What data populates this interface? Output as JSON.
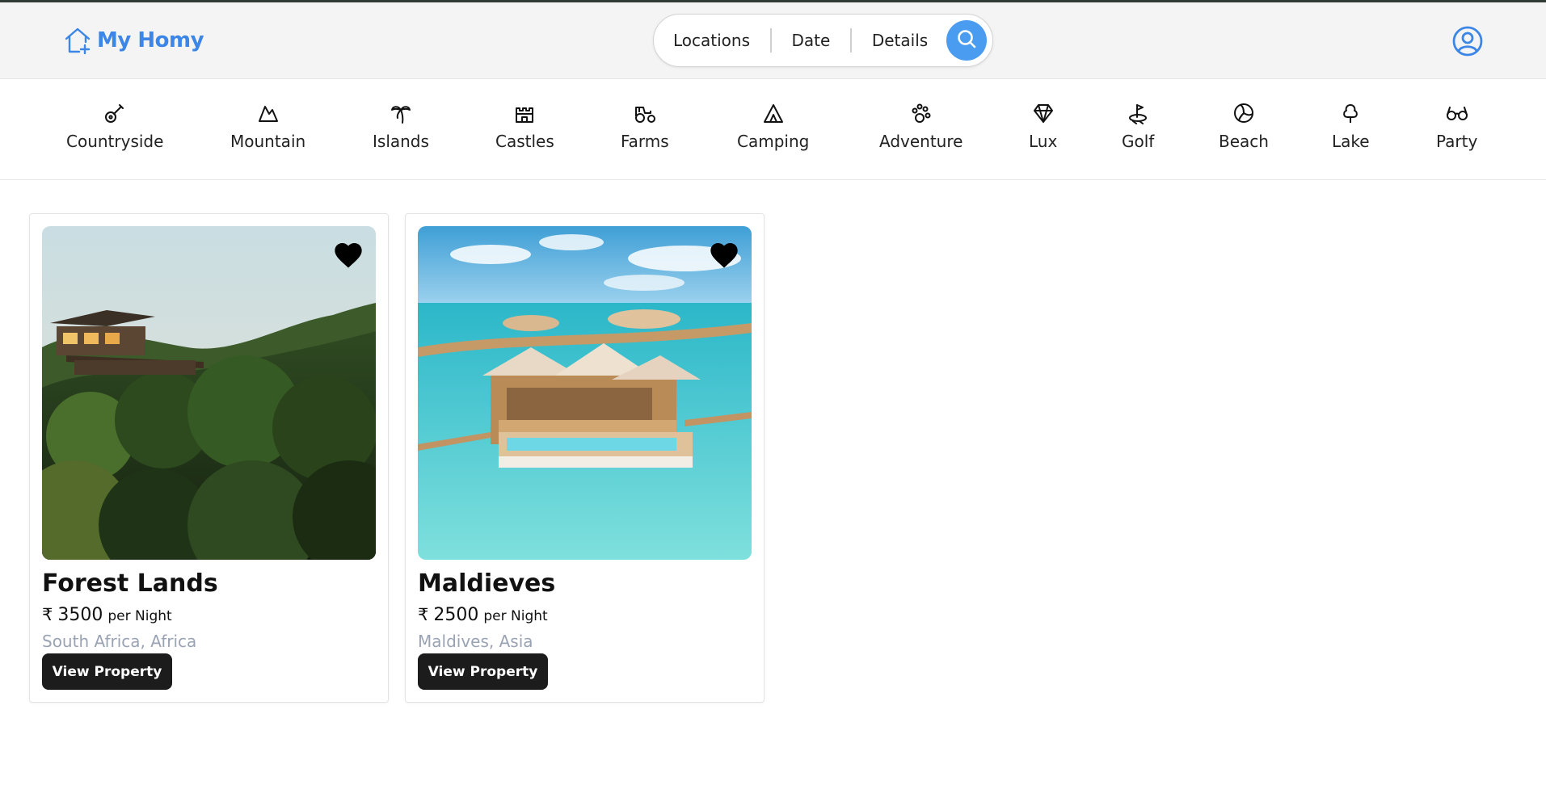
{
  "app": {
    "name": "My Homy",
    "brand_color": "#3b86e6"
  },
  "search": {
    "segments": [
      "Locations",
      "Date",
      "Details"
    ],
    "button_icon": "search-icon",
    "button_color": "#4a9cf0"
  },
  "header": {
    "profile_icon": "user-circle-icon"
  },
  "categories": [
    {
      "label": "Countryside",
      "icon": "guitar-icon"
    },
    {
      "label": "Mountain",
      "icon": "mountain-icon"
    },
    {
      "label": "Islands",
      "icon": "palm-tree-icon"
    },
    {
      "label": "Castles",
      "icon": "castle-icon"
    },
    {
      "label": "Farms",
      "icon": "tractor-icon"
    },
    {
      "label": "Camping",
      "icon": "tent-icon"
    },
    {
      "label": "Adventure",
      "icon": "paw-icon"
    },
    {
      "label": "Lux",
      "icon": "diamond-icon"
    },
    {
      "label": "Golf",
      "icon": "golf-icon"
    },
    {
      "label": "Beach",
      "icon": "volleyball-icon"
    },
    {
      "label": "Lake",
      "icon": "tree-icon"
    },
    {
      "label": "Party",
      "icon": "glasses-icon"
    }
  ],
  "listings": [
    {
      "title": "Forest Lands",
      "currency": "₹",
      "price": "3500",
      "per": "per Night",
      "location": "South Africa, Africa",
      "button": "View Property",
      "favorite_icon": "heart-icon"
    },
    {
      "title": "Maldieves",
      "currency": "₹",
      "price": "2500",
      "per": "per Night",
      "location": "Maldives, Asia",
      "button": "View Property",
      "favorite_icon": "heart-icon"
    }
  ]
}
